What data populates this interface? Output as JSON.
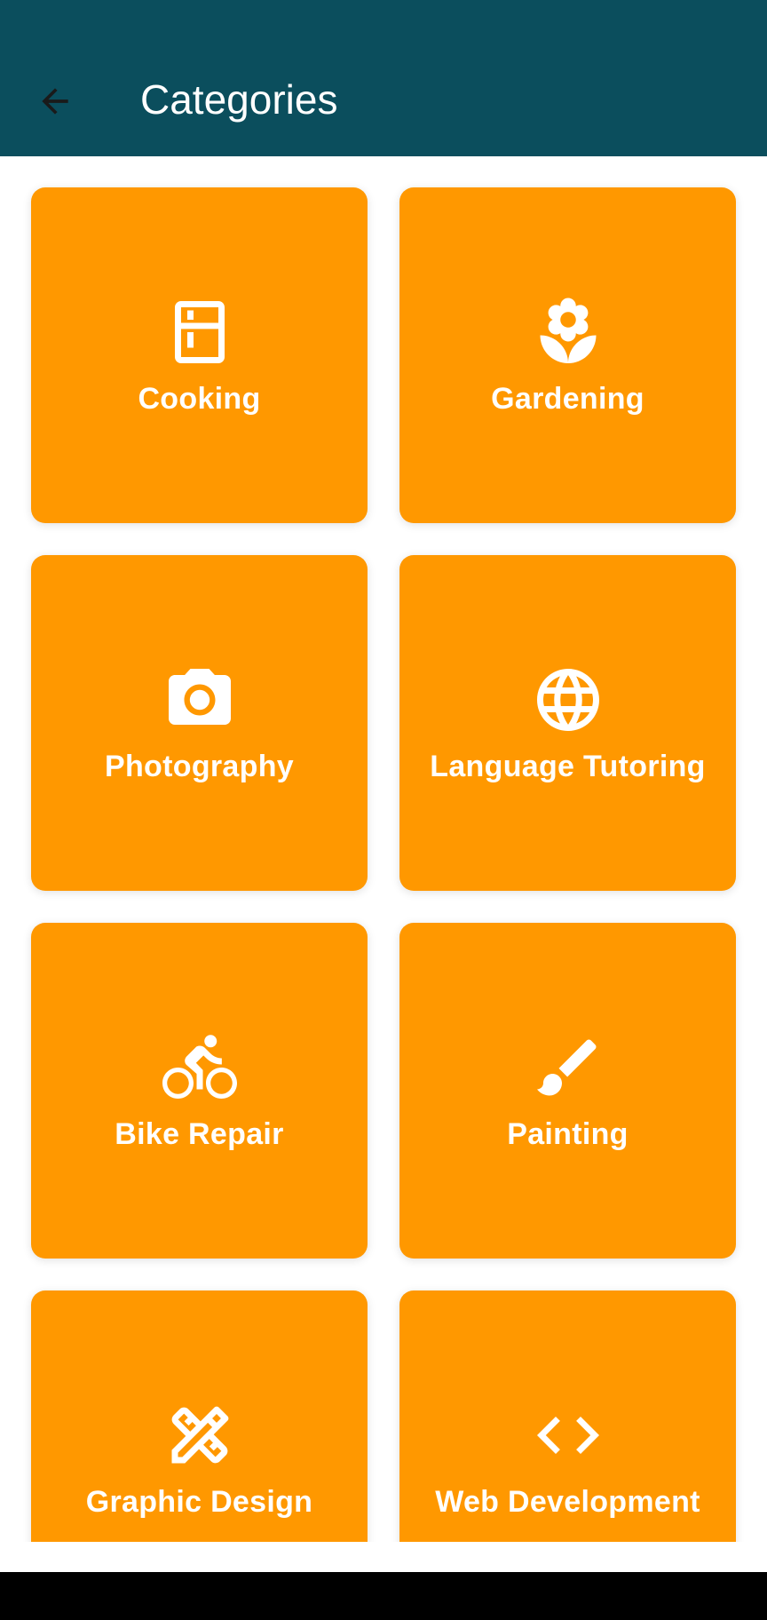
{
  "app_bar": {
    "title": "Categories",
    "back_icon": "arrow-back-icon",
    "background_color": "#0b4e5d"
  },
  "tile_color": "#ff9800",
  "categories": [
    {
      "label": "Cooking",
      "icon": "kitchen-icon"
    },
    {
      "label": "Gardening",
      "icon": "flower-icon"
    },
    {
      "label": "Photography",
      "icon": "camera-icon"
    },
    {
      "label": "Language Tutoring",
      "icon": "globe-icon"
    },
    {
      "label": "Bike Repair",
      "icon": "bicycle-icon"
    },
    {
      "label": "Painting",
      "icon": "brush-icon"
    },
    {
      "label": "Graphic Design",
      "icon": "design-tools-icon"
    },
    {
      "label": "Web Development",
      "icon": "code-icon"
    }
  ]
}
